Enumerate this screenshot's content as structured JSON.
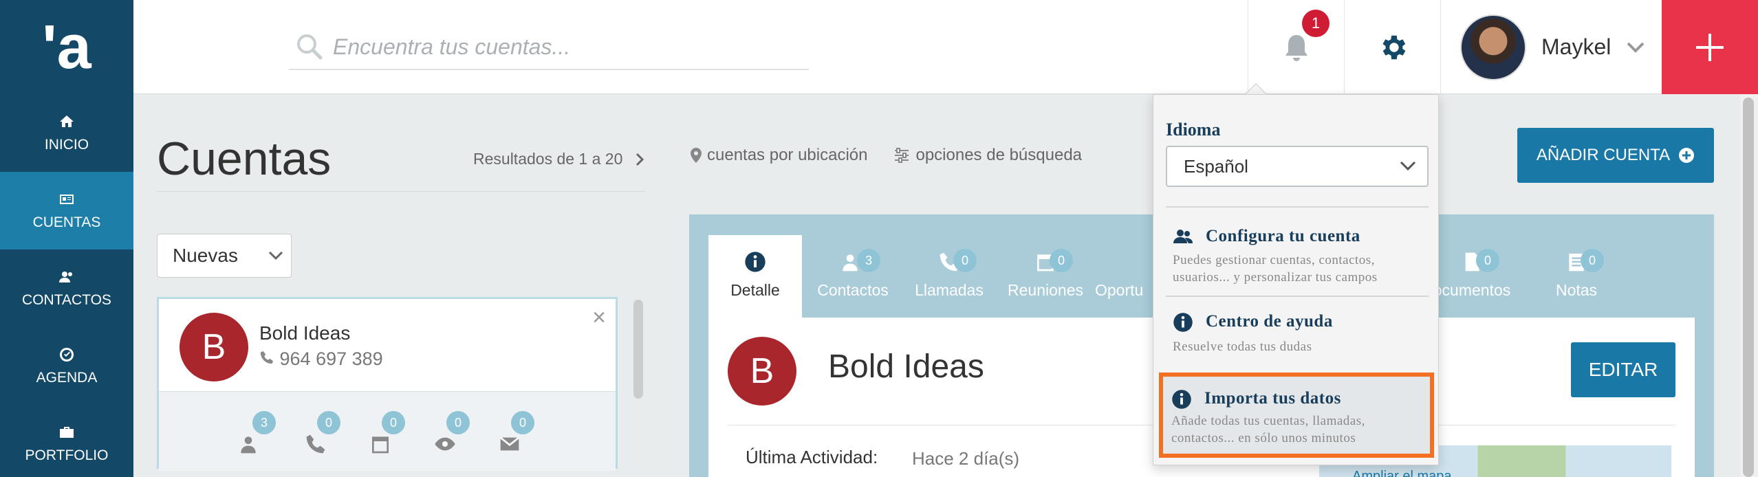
{
  "sidebar": {
    "logo": "'a",
    "items": [
      {
        "label": "INICIO",
        "icon": "home-icon"
      },
      {
        "label": "CUENTAS",
        "icon": "id-card-icon",
        "active": true
      },
      {
        "label": "CONTACTOS",
        "icon": "contacts-icon"
      },
      {
        "label": "AGENDA",
        "icon": "check-circle-icon"
      },
      {
        "label": "PORTFOLIO",
        "icon": "briefcase-icon"
      }
    ]
  },
  "header": {
    "search_placeholder": "Encuentra tus cuentas...",
    "notifications_count": "1",
    "user_name": "Maykel",
    "plus_label": "+"
  },
  "page": {
    "title": "Cuentas",
    "results": "Resultados de 1 a 20",
    "link_location": "cuentas por ubicación",
    "link_search": "opciones de búsqueda",
    "add_button": "AÑADIR CUENTA",
    "filter_value": "Nuevas"
  },
  "account_card": {
    "initial": "B",
    "name": "Bold Ideas",
    "phone": "964 697 389",
    "counts": [
      "3",
      "0",
      "0",
      "0",
      "0"
    ]
  },
  "detail": {
    "tabs": [
      {
        "label": "Detalle",
        "count": null
      },
      {
        "label": "Contactos",
        "count": "3"
      },
      {
        "label": "Llamadas",
        "count": "0"
      },
      {
        "label": "Reuniones",
        "count": "0"
      },
      {
        "label": "Oportu",
        "count": null
      },
      {
        "label": "ocumentos",
        "count": "0"
      },
      {
        "label": "Notas",
        "count": "0"
      }
    ],
    "initial": "B",
    "name": "Bold Ideas",
    "edit_button": "EDITAR",
    "last_activity_label": "Última Actividad:",
    "last_activity_value": "Hace 2 día(s)",
    "map_link": "Ampliar el mapa"
  },
  "settings_menu": {
    "language_label": "Idioma",
    "language_value": "Español",
    "items": [
      {
        "title": "Configura tu cuenta",
        "desc": "Puedes gestionar cuentas, contactos, usuarios... y personalizar tus campos",
        "icon": "users-icon"
      },
      {
        "title": "Centro de ayuda",
        "desc": "Resuelve todas tus dudas",
        "icon": "info-icon"
      },
      {
        "title": "Importa tus datos",
        "desc": "Añade todas tus cuentas, llamadas, contactos... en sólo unos minutos",
        "icon": "info-icon",
        "highlighted": true
      }
    ]
  },
  "colors": {
    "sidebar": "#134867",
    "sidebar_active": "#1d7ea8",
    "accent_red": "#e8334a",
    "primary_button": "#1a78a6",
    "highlight_border": "#f36f21"
  }
}
